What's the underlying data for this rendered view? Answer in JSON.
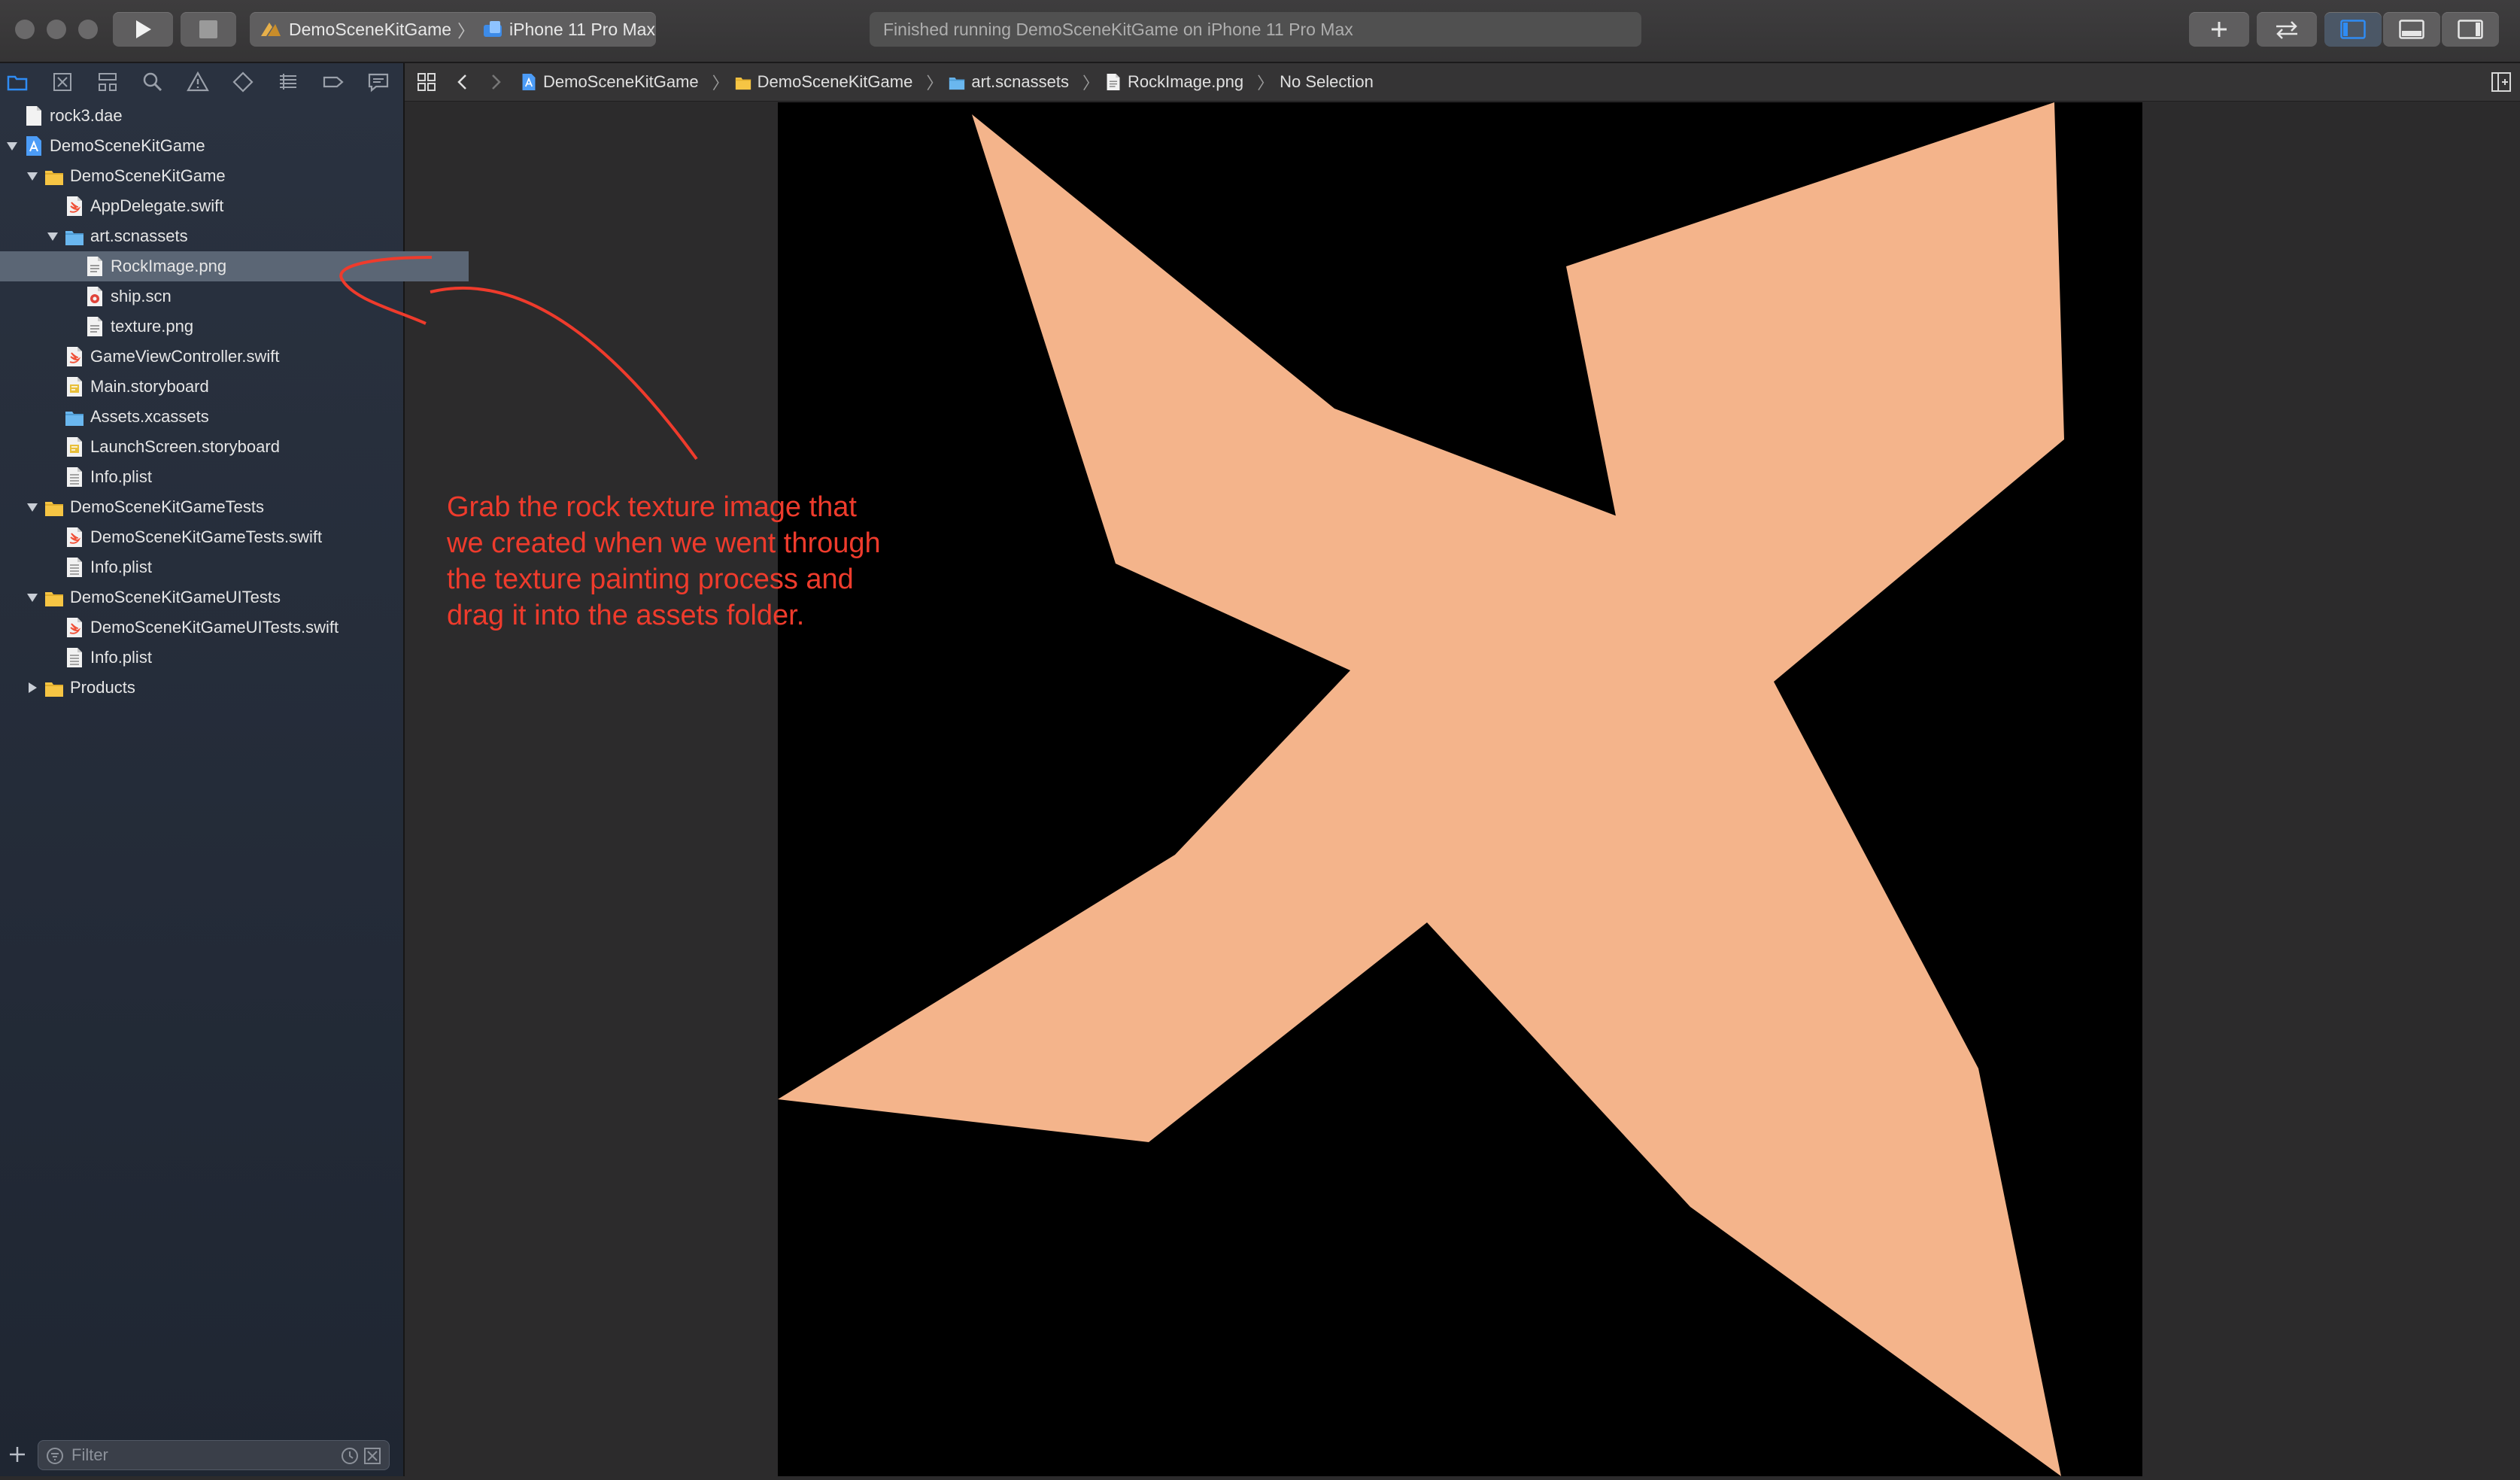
{
  "toolbar": {
    "scheme_name": "DemoSceneKitGame",
    "device_name": "iPhone 11 Pro Max",
    "status_text": "Finished running DemoSceneKitGame on iPhone 11 Pro Max"
  },
  "navigator": {
    "tabs": [
      "folder-icon",
      "source-control-icon",
      "hierarchy-icon",
      "search-icon",
      "warning-icon",
      "test-icon",
      "debug-icon",
      "breakpoint-icon",
      "report-icon"
    ],
    "items": [
      {
        "label": "rock3.dae",
        "depth": 0,
        "kind": "file",
        "disclosure": "none"
      },
      {
        "label": "DemoSceneKitGame",
        "depth": 0,
        "kind": "project",
        "disclosure": "open"
      },
      {
        "label": "DemoSceneKitGame",
        "depth": 1,
        "kind": "folder",
        "disclosure": "open"
      },
      {
        "label": "AppDelegate.swift",
        "depth": 2,
        "kind": "swift",
        "disclosure": "none"
      },
      {
        "label": "art.scnassets",
        "depth": 2,
        "kind": "bluefolder",
        "disclosure": "open"
      },
      {
        "label": "RockImage.png",
        "depth": 3,
        "kind": "image",
        "disclosure": "none",
        "selected": true
      },
      {
        "label": "ship.scn",
        "depth": 3,
        "kind": "scene",
        "disclosure": "none"
      },
      {
        "label": "texture.png",
        "depth": 3,
        "kind": "image",
        "disclosure": "none"
      },
      {
        "label": "GameViewController.swift",
        "depth": 2,
        "kind": "swift",
        "disclosure": "none"
      },
      {
        "label": "Main.storyboard",
        "depth": 2,
        "kind": "storyboard",
        "disclosure": "none"
      },
      {
        "label": "Assets.xcassets",
        "depth": 2,
        "kind": "bluefolder",
        "disclosure": "none"
      },
      {
        "label": "LaunchScreen.storyboard",
        "depth": 2,
        "kind": "storyboard",
        "disclosure": "none"
      },
      {
        "label": "Info.plist",
        "depth": 2,
        "kind": "plist",
        "disclosure": "none"
      },
      {
        "label": "DemoSceneKitGameTests",
        "depth": 1,
        "kind": "folder",
        "disclosure": "open"
      },
      {
        "label": "DemoSceneKitGameTests.swift",
        "depth": 2,
        "kind": "swift",
        "disclosure": "none"
      },
      {
        "label": "Info.plist",
        "depth": 2,
        "kind": "plist",
        "disclosure": "none"
      },
      {
        "label": "DemoSceneKitGameUITests",
        "depth": 1,
        "kind": "folder",
        "disclosure": "open"
      },
      {
        "label": "DemoSceneKitGameUITests.swift",
        "depth": 2,
        "kind": "swift",
        "disclosure": "none"
      },
      {
        "label": "Info.plist",
        "depth": 2,
        "kind": "plist",
        "disclosure": "none"
      },
      {
        "label": "Products",
        "depth": 1,
        "kind": "folder",
        "disclosure": "closed"
      }
    ],
    "filter_placeholder": "Filter"
  },
  "jumpbar": {
    "crumbs": [
      {
        "label": "DemoSceneKitGame",
        "icon": "project"
      },
      {
        "label": "DemoSceneKitGame",
        "icon": "folder"
      },
      {
        "label": "art.scnassets",
        "icon": "bluefolder"
      },
      {
        "label": "RockImage.png",
        "icon": "image"
      },
      {
        "label": "No Selection",
        "icon": "none"
      }
    ]
  },
  "annotation": {
    "lines": [
      "Grab the rock texture image that",
      "we created when we went through",
      "the texture painting process and",
      "drag it into the assets folder."
    ]
  },
  "colors": {
    "accent": "#2f8cf4",
    "selection": "#5b6675",
    "texture_fill": "#f4b48b",
    "annotation": "#ef3b2c"
  }
}
